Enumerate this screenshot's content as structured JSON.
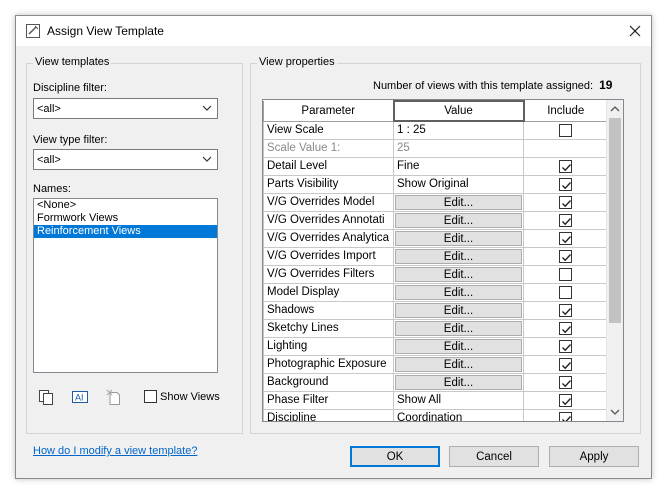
{
  "window": {
    "title": "Assign View Template"
  },
  "left": {
    "group_label": "View templates",
    "discipline_label": "Discipline filter:",
    "discipline_value": "<all>",
    "viewtype_label": "View type filter:",
    "viewtype_value": "<all>",
    "names_label": "Names:",
    "names": [
      "<None>",
      "Formwork Views",
      "Reinforcement Views"
    ],
    "selected_index": 2,
    "show_views_label": "Show Views"
  },
  "right": {
    "group_label": "View properties",
    "count_label": "Number of views with this template assigned:",
    "count_value": "19",
    "columns": [
      "Parameter",
      "Value",
      "Include"
    ],
    "rows": [
      {
        "param": "View Scale",
        "value": "1 : 25",
        "type": "text",
        "include": false,
        "dim": false
      },
      {
        "param": "Scale Value    1:",
        "value": "25",
        "type": "text",
        "include": null,
        "dim": true
      },
      {
        "param": "Detail Level",
        "value": "Fine",
        "type": "text",
        "include": true,
        "dim": false
      },
      {
        "param": "Parts Visibility",
        "value": "Show Original",
        "type": "text",
        "include": true,
        "dim": false
      },
      {
        "param": "V/G Overrides Model",
        "value": "Edit...",
        "type": "button",
        "include": true,
        "dim": false
      },
      {
        "param": "V/G Overrides Annotati",
        "value": "Edit...",
        "type": "button",
        "include": true,
        "dim": false
      },
      {
        "param": "V/G Overrides Analytica",
        "value": "Edit...",
        "type": "button",
        "include": true,
        "dim": false
      },
      {
        "param": "V/G Overrides Import",
        "value": "Edit...",
        "type": "button",
        "include": true,
        "dim": false
      },
      {
        "param": "V/G Overrides Filters",
        "value": "Edit...",
        "type": "button",
        "include": false,
        "dim": false
      },
      {
        "param": "Model Display",
        "value": "Edit...",
        "type": "button",
        "include": false,
        "dim": false
      },
      {
        "param": "Shadows",
        "value": "Edit...",
        "type": "button",
        "include": true,
        "dim": false
      },
      {
        "param": "Sketchy Lines",
        "value": "Edit...",
        "type": "button",
        "include": true,
        "dim": false
      },
      {
        "param": "Lighting",
        "value": "Edit...",
        "type": "button",
        "include": true,
        "dim": false
      },
      {
        "param": "Photographic Exposure",
        "value": "Edit...",
        "type": "button",
        "include": true,
        "dim": false
      },
      {
        "param": "Background",
        "value": "Edit...",
        "type": "button",
        "include": true,
        "dim": false
      },
      {
        "param": "Phase Filter",
        "value": "Show All",
        "type": "text",
        "include": true,
        "dim": false
      },
      {
        "param": "Discipline",
        "value": "Coordination",
        "type": "text",
        "include": true,
        "dim": false
      }
    ]
  },
  "footer": {
    "help_link": "How do I modify a view template?",
    "ok_label": "OK",
    "cancel_label": "Cancel",
    "apply_label": "Apply"
  },
  "colors": {
    "accent": "#0078d7",
    "link": "#0066cc"
  },
  "icons": [
    "app-icon",
    "close-icon",
    "duplicate-icon",
    "rename-icon",
    "delete-icon",
    "chevron-down-icon",
    "checkmark-icon"
  ]
}
